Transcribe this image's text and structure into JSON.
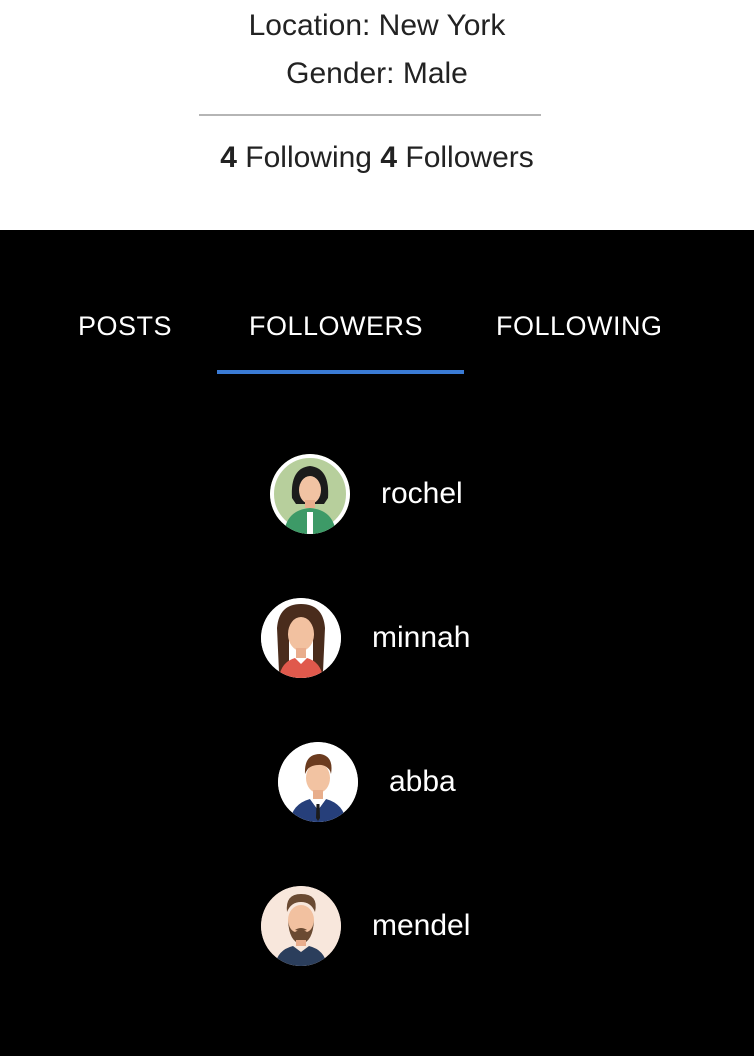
{
  "profile": {
    "location": "Location: New York",
    "gender": "Gender: Male",
    "following_count": "4",
    "following_label": "Following",
    "followers_count": "4",
    "followers_label": "Followers"
  },
  "tabs": [
    {
      "label": "POSTS",
      "active": false
    },
    {
      "label": "FOLLOWERS",
      "active": true
    },
    {
      "label": "FOLLOWING",
      "active": false
    }
  ],
  "colors": {
    "accent": "#3a7bd5",
    "page_background": "#000000",
    "header_background": "#ffffff"
  },
  "followers": [
    {
      "username": "rochel",
      "avatar": "woman-green-shirt-avatar-icon"
    },
    {
      "username": "minnah",
      "avatar": "woman-long-hair-avatar-icon"
    },
    {
      "username": "abba",
      "avatar": "man-suit-avatar-icon"
    },
    {
      "username": "mendel",
      "avatar": "bearded-man-avatar-icon"
    }
  ]
}
